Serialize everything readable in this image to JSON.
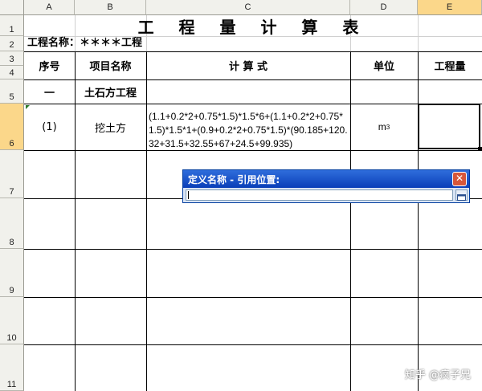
{
  "columns": [
    "A",
    "B",
    "C",
    "D",
    "E"
  ],
  "rows": [
    "1",
    "2",
    "3",
    "4",
    "5",
    "6",
    "7",
    "8",
    "9",
    "10",
    "11"
  ],
  "sheet": {
    "title": "工 程 量 计 算 表",
    "project_name": "工程名称：＊＊＊＊工程",
    "headers": {
      "seq": "序号",
      "item": "项目名称",
      "formula": "计  算  式",
      "unit": "单位",
      "quantity": "工程量"
    },
    "section": {
      "seq": "一",
      "item": "土石方工程"
    },
    "row1": {
      "seq": "(1)",
      "item": "挖土方",
      "formula": "(1.1+0.2*2+0.75*1.5)*1.5*6+(1.1+0.2*2+0.75*1.5)*1.5*1+(0.9+0.2*2+0.75*1.5)*(90.185+120.32+31.5+32.55+67+24.5+99.935)",
      "unit_base": "m",
      "unit_exp": "3",
      "quantity": ""
    }
  },
  "dialog": {
    "title": "定义名称 - 引用位置:",
    "input_value": "",
    "close_glyph": "✕"
  },
  "watermark": "知乎 @疯子兄"
}
